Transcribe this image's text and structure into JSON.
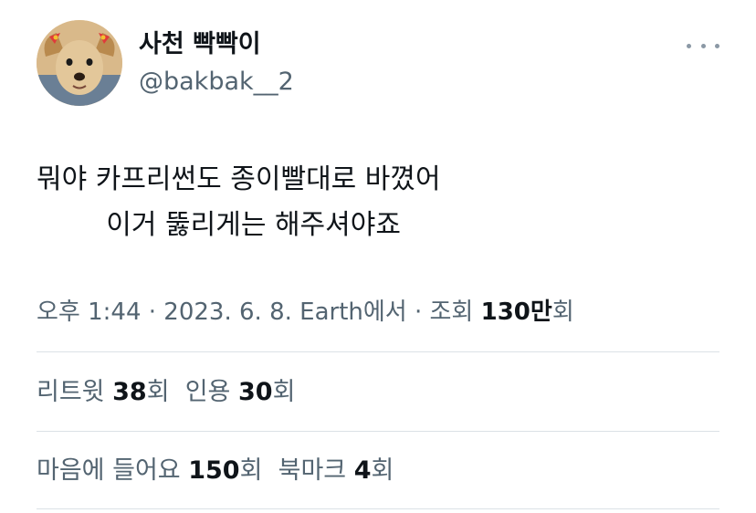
{
  "user": {
    "display_name": "사천 빡빡이",
    "handle": "@bakbak__2",
    "avatar_icon": "dog-avatar-icon"
  },
  "menu": {
    "icon": "more-icon"
  },
  "tweet": {
    "text": "뭐야 카프리썬도 종이빨대로 바꼈어\n        이거 뚫리게는 해주셔야죠"
  },
  "meta": {
    "time": "오후 1:44",
    "separator": " · ",
    "date": "2023. 6. 8.",
    "source": "Earth에서",
    "views_label": "조회",
    "views_number": "130만",
    "views_unit": "회"
  },
  "stats": {
    "retweets": {
      "label": "리트윗",
      "value": "38",
      "unit": "회"
    },
    "quotes": {
      "label": "인용",
      "value": "30",
      "unit": "회"
    },
    "likes": {
      "label": "마음에 들어요",
      "value": "150",
      "unit": "회"
    },
    "bookmarks": {
      "label": "북마크",
      "value": "4",
      "unit": "회"
    }
  },
  "colors": {
    "text_primary": "#0f1419",
    "text_secondary": "#536471",
    "divider": "#dbe1e6"
  }
}
